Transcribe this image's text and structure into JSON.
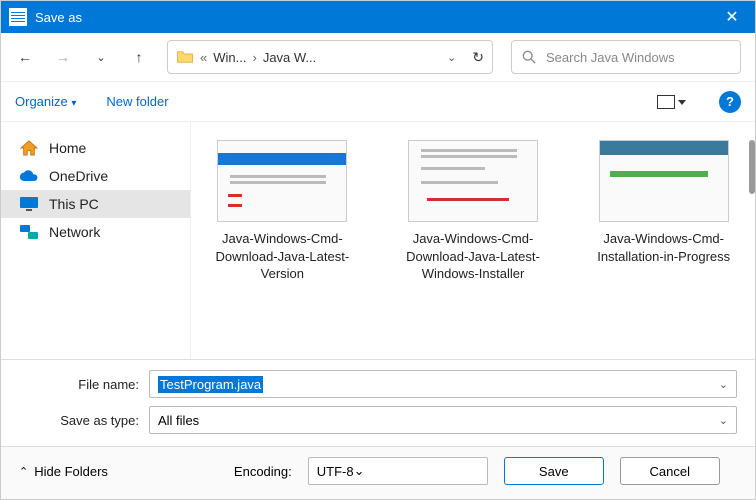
{
  "window": {
    "title": "Save as"
  },
  "nav": {
    "crumb1": "Win...",
    "crumb2": "Java W...",
    "searchPlaceholder": "Search Java Windows"
  },
  "toolbar": {
    "organize": "Organize",
    "newFolder": "New folder"
  },
  "sidebar": {
    "items": [
      {
        "label": "Home"
      },
      {
        "label": "OneDrive"
      },
      {
        "label": "This PC"
      },
      {
        "label": "Network"
      }
    ]
  },
  "files": [
    {
      "name": "Java-Windows-Cmd-Download-Java-Latest-Version"
    },
    {
      "name": "Java-Windows-Cmd-Download-Java-Latest-Windows-Installer"
    },
    {
      "name": "Java-Windows-Cmd-Installation-in-Progress"
    }
  ],
  "form": {
    "fileNameLabel": "File name:",
    "fileNameValue": "TestProgram.java",
    "saveTypeLabel": "Save as type:",
    "saveTypeValue": "All files"
  },
  "footer": {
    "hideFolders": "Hide Folders",
    "encodingLabel": "Encoding:",
    "encodingValue": "UTF-8",
    "save": "Save",
    "cancel": "Cancel"
  }
}
